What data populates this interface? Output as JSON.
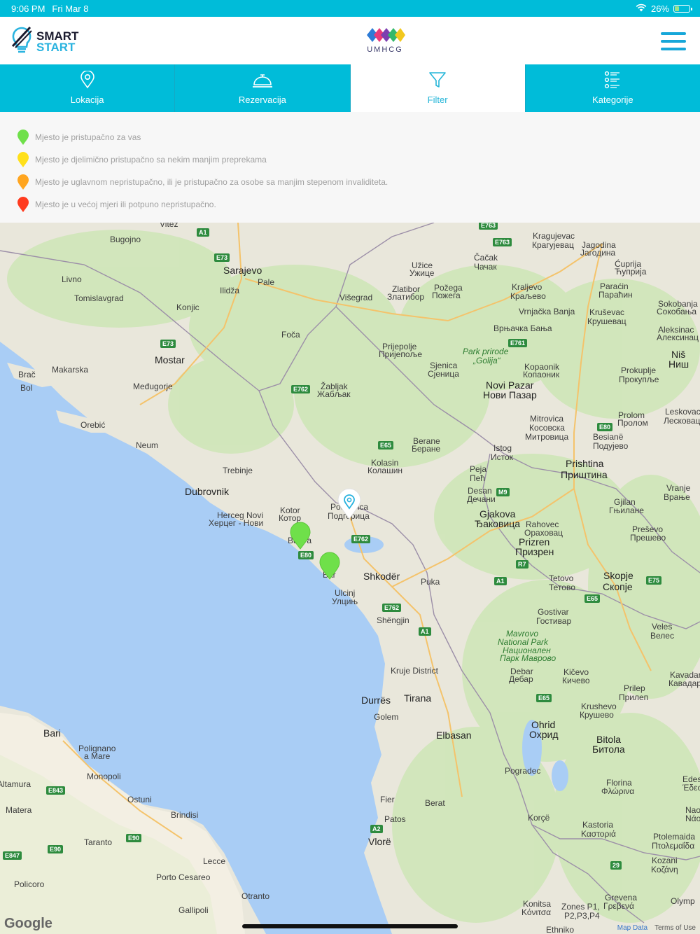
{
  "status_bar": {
    "time": "9:06 PM",
    "date": "Fri Mar 8",
    "battery": "26%"
  },
  "header": {
    "logo_line1": "SMART",
    "logo_line2": "START",
    "center_logo_caption": "UMHCG"
  },
  "tabs": [
    {
      "label": "Lokacija",
      "icon": "location-pin-icon"
    },
    {
      "label": "Rezervacija",
      "icon": "service-bell-icon"
    },
    {
      "label": "Filter",
      "icon": "filter-icon"
    },
    {
      "label": "Kategorije",
      "icon": "list-icon"
    }
  ],
  "legend": [
    {
      "text": "Mjesto je pristupačno za vas",
      "color": "#6fe04a"
    },
    {
      "text": "Mjesto je djelimično pristupačno sa nekim manjim preprekama",
      "color": "#ffe01a"
    },
    {
      "text": "Mjesto je uglavnom nepristupačno, ili je pristupačno za osobe sa manjim stepenom invaliditeta.",
      "color": "#ffa51f"
    },
    {
      "text": "Mjesto je u većoj mjeri ili potpuno nepristupačno.",
      "color": "#ff3b1f"
    }
  ],
  "map": {
    "labels": [
      "Vitez",
      "Bugojno",
      "Livno",
      "Tomislavgrad",
      "Sarajevo",
      "Pale",
      "Ilidža",
      "Konjic",
      "Mostar",
      "Makarska",
      "Brač",
      "Bol",
      "Međugorje",
      "Orebić",
      "Neum",
      "Trebinje",
      "Dubrovnik",
      "Herceg Novi",
      "Херцег - Нови",
      "Kotor",
      "Котор",
      "Foča",
      "Višegrad",
      "Žabljak",
      "Жабљак",
      "Prijepolje",
      "Пријепоље",
      "Zlatibor",
      "Златибор",
      "Užice",
      "Ужице",
      "Požega",
      "Пожега",
      "Čačak",
      "Чачак",
      "Kragujevac",
      "Крагујевац",
      "Jagodina",
      "Јагодина",
      "Kraljevo",
      "Краљево",
      "Vrnjačka Banja",
      "Врњачка Бања",
      "Kruševac",
      "Крушевац",
      "Ćuprija",
      "Ћуприја",
      "Paraćin",
      "Параћин",
      "Sokobanja",
      "Сокобања",
      "Aleksinac",
      "Алексинац",
      "Niš",
      "Ниш",
      "Park prirode",
      "„Golija“",
      "Sjenica",
      "Сјеница",
      "Kopaonik",
      "Копаоник",
      "Novi Pazar",
      "Нови Пазар",
      "Prokuplje",
      "Прокупље",
      "Leskovac",
      "Лесковац",
      "Mitrovica",
      "Косовска",
      "Митровица",
      "Prolom",
      "Пролом",
      "Besianë",
      "Подујево",
      "Berane",
      "Беране",
      "Kolasin",
      "Колашин",
      "Istog",
      "Исток",
      "Peja",
      "Пеħ",
      "Prishtina",
      "Приштина",
      "Podgorica",
      "Подгорица",
      "Desan",
      "Дечани",
      "Gjakova",
      "Ђаковица",
      "Rahovec",
      "Ораховац",
      "Gjilan",
      "Гњилане",
      "Vranje",
      "Врање",
      "Preševo",
      "Прешево",
      "Prizren",
      "Призрен",
      "Shkodër",
      "Puka",
      "Ulcinj",
      "Улцињ",
      "Shëngjin",
      "Budva",
      "Bar",
      "Tetovo",
      "Тетово",
      "Skopje",
      "Скопје",
      "Gostivar",
      "Гостивар",
      "Mavrovo",
      "National Park",
      "Национален",
      "Парк Маврово",
      "Veles",
      "Велес",
      "Kavadar",
      "Кавадар",
      "Debar",
      "Дебар",
      "Kičevo",
      "Кичево",
      "Prilep",
      "Прилеп",
      "Krushevo",
      "Крушево",
      "Kruje District",
      "Durrës",
      "Tirana",
      "Golem",
      "Elbasan",
      "Ohrid",
      "Охрид",
      "Bitola",
      "Битола",
      "Pogradec",
      "Florina",
      "Φλώρινα",
      "Edessa",
      "Έδεσσα",
      "Naousa",
      "Νάουσα",
      "Bari",
      "Polignano",
      "a Mare",
      "Monopoli",
      "Altamura",
      "Matera",
      "Ostuni",
      "Brindisi",
      "Taranto",
      "Lecce",
      "Porto Cesareo",
      "Otranto",
      "Gallipoli",
      "Policoro",
      "Fier",
      "Patos",
      "Berat",
      "Vlorë",
      "Korçë",
      "Kastoria",
      "Καστοριά",
      "Ptolemaida",
      "Πτολεμαΐδα",
      "Kozani",
      "Κοζάνη",
      "Grevena",
      "Γρεβενά",
      "Konitsa",
      "Κόνιτσα",
      "Zones P1,",
      "P2,P3,P4",
      "Ethniko",
      "Olymp"
    ],
    "roads": [
      "A1",
      "E73",
      "E73",
      "E762",
      "E65",
      "E762",
      "E80",
      "E762",
      "A1",
      "E763",
      "E763",
      "E761",
      "E80",
      "M9",
      "R7",
      "A1",
      "E65",
      "E75",
      "E65",
      "E843",
      "E90",
      "E90",
      "E847",
      "A2",
      "29"
    ],
    "attribution_logo": "Google",
    "map_data_label": "Map Data",
    "terms_label": "Terms of Use"
  },
  "markers": [
    {
      "color": "#6fe04a"
    },
    {
      "color": "#6fe04a"
    },
    {
      "color": "#ffffff",
      "icon": "location-pin-icon"
    }
  ]
}
